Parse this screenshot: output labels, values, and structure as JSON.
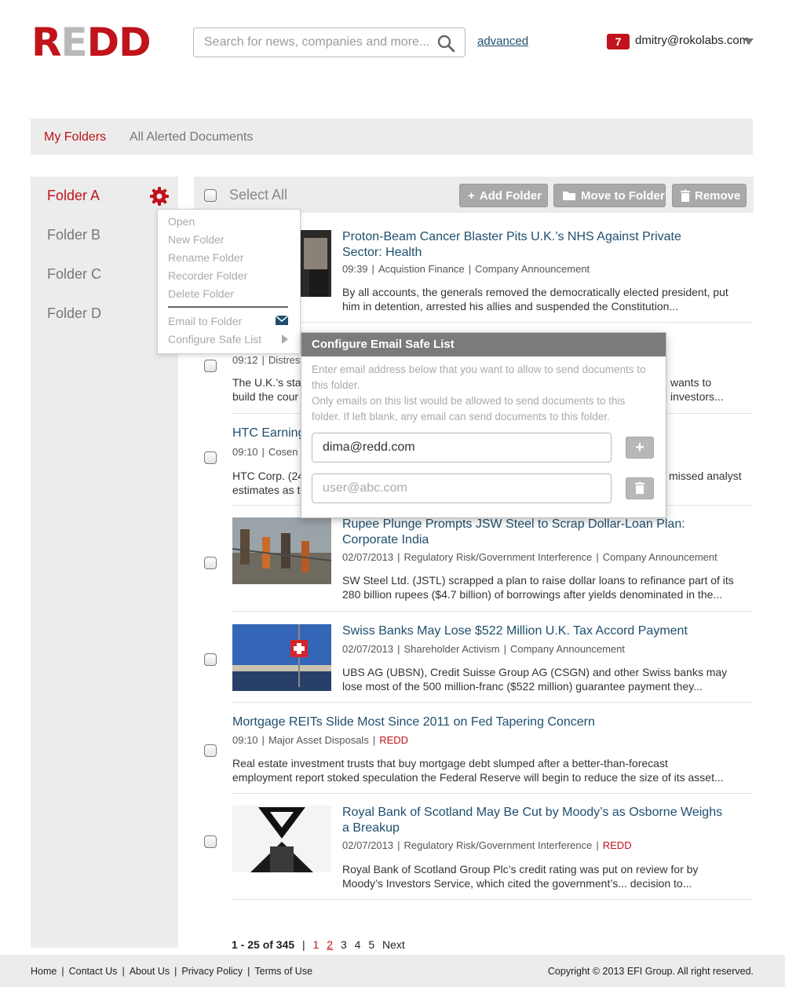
{
  "header": {
    "logo_text_r": "R",
    "logo_text_e": "E",
    "logo_text_dd": "DD",
    "search_placeholder": "Search for news, companies and more...",
    "advanced_label": "advanced",
    "notification_count": "7",
    "user_email": "dmitry@rokolabs.com"
  },
  "tabs": {
    "my_folders": "My Folders",
    "all_alerted": "All Alerted Documents"
  },
  "sidebar": {
    "folders": [
      "Folder A",
      "Folder B",
      "Folder C",
      "Folder D"
    ]
  },
  "context_menu": {
    "items": [
      "Open",
      "New Folder",
      "Rename Folder",
      "Recorder Folder",
      "Delete Folder"
    ],
    "email_to_folder": "Email to Folder",
    "configure_safe_list": "Configure Safe List"
  },
  "toolbar": {
    "select_all": "Select All",
    "add_folder": "Add Folder",
    "move_to_folder": "Move to Folder",
    "remove": "Remove"
  },
  "articles": [
    {
      "title_line1": "Proton-Beam Cancer Blaster Pits U.K.’s NHS Against Private",
      "title_line2": "Sector: Health",
      "time": "09:39",
      "tags": [
        "Acquistion Finance",
        "Company Announcement"
      ],
      "body_line1": "By all accounts, the generals removed the democratically elected president, put",
      "body_line2": "him in detention, arrested his allies and suspended the Constitution..."
    },
    {
      "time": "09:12",
      "tag_partial": "Distres",
      "body_line1": "The U.K.’s sta",
      "body_line1_end": "wants to",
      "body_line2": "build the cour",
      "body_line2_end": "investors..."
    },
    {
      "title_partial": "HTC Earning",
      "time": "09:10",
      "tag_partial": "Cosen",
      "body_line1": "HTC Corp. (24",
      "body_line1_end": "missed analyst",
      "body_line2": "estimates as t"
    },
    {
      "title_line1": "Rupee Plunge Prompts JSW Steel to Scrap Dollar-Loan Plan:",
      "title_line2": "Corporate India",
      "time": "02/07/2013",
      "tags": [
        "Regulatory Risk/Government Interference",
        "Company Announcement"
      ],
      "body_line1": "SW Steel Ltd. (JSTL) scrapped a plan to raise dollar loans to refinance part of its",
      "body_line2": "280 billion rupees ($4.7 billion) of borrowings after yields denominated in the..."
    },
    {
      "title_line1": "Swiss Banks May Lose $522 Million U.K. Tax Accord Payment",
      "time": "02/07/2013",
      "tags": [
        "Shareholder Activism",
        "Company Announcement"
      ],
      "body_line1": "UBS AG (UBSN), Credit Suisse Group AG (CSGN) and other Swiss banks may",
      "body_line2": "lose most of the 500 million-franc ($522 million) guarantee payment they..."
    },
    {
      "title_line1": "Mortgage REITs Slide Most Since 2011 on Fed Tapering Concern",
      "time": "09:10",
      "tag1": "Major Asset Disposals",
      "tag_red": "REDD",
      "body_line1": "Real estate investment trusts that buy mortgage debt slumped after a better-than-forecast",
      "body_line2": "employment report stoked speculation the Federal Reserve will begin to reduce the size of its asset..."
    },
    {
      "title_line1": "Royal Bank of Scotland May Be Cut by Moody’s as Osborne Weighs",
      "title_line2": "a Breakup",
      "time": "02/07/2013",
      "tag1": "Regulatory Risk/Government Interference",
      "tag_red": "REDD",
      "body_line1": "Royal Bank of Scotland Group Plc’s credit rating was put on review for by",
      "body_line2": "Moody’s Investors Service, which cited the government’s... decision to..."
    }
  ],
  "modal": {
    "title": "Configure Email Safe List",
    "desc_line1": "Enter email address below that you want to allow to send documents to",
    "desc_line2": "this folder.",
    "desc_line3": "Only emails on this list would be allowed to send documents to this",
    "desc_line4": "folder. If left blank, any email can send documents to this folder.",
    "email_value": "dima@redd.com",
    "email_placeholder": "user@abc.com"
  },
  "pagination": {
    "range": "1 - 25 of 345",
    "sep": "|",
    "pages": [
      "1",
      "2",
      "3",
      "4",
      "5"
    ],
    "next": "Next"
  },
  "footer": {
    "links": [
      "Home",
      "Contact Us",
      "About Us",
      "Privacy Policy",
      "Terms of Use"
    ],
    "copyright": "Copyright © 2013 EFI Group. All right reserved."
  }
}
